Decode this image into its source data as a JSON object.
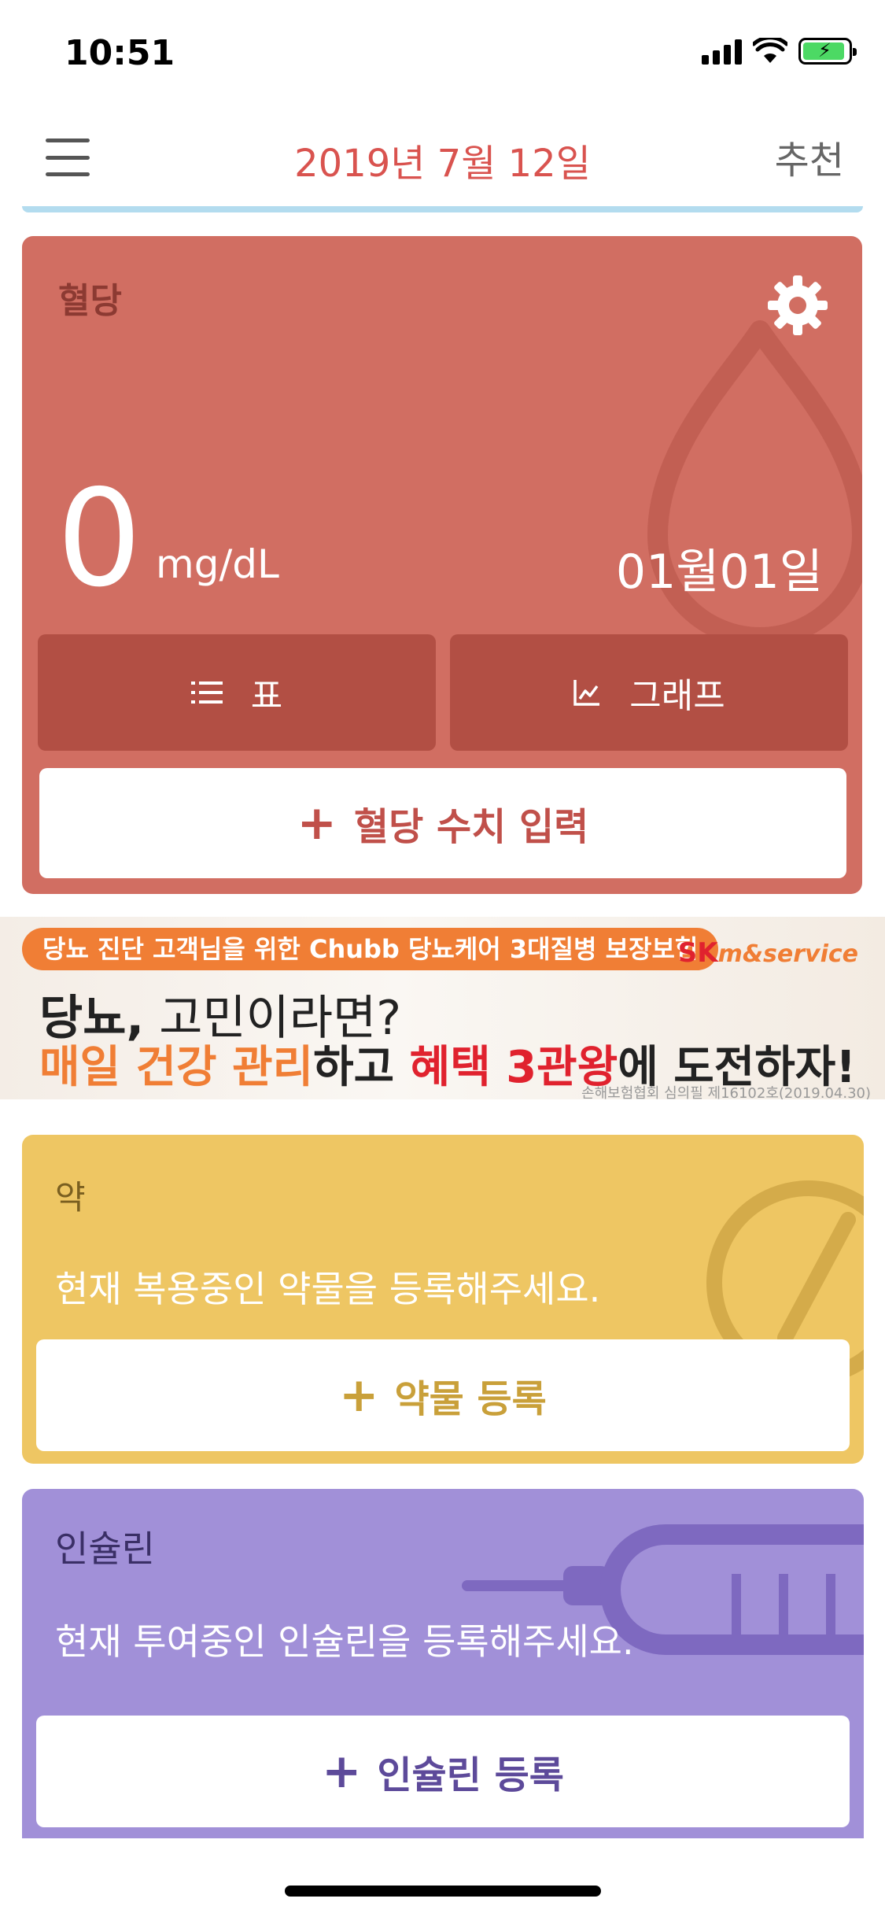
{
  "status_bar": {
    "time": "10:51"
  },
  "header": {
    "date": "2019년 7월 12일",
    "recommend_label": "추천"
  },
  "blood_sugar": {
    "title": "혈당",
    "value": "0",
    "unit": "mg/dL",
    "date": "01월01일",
    "table_label": "표",
    "graph_label": "그래프",
    "input_label": "혈당 수치 입력",
    "colors": {
      "card": "#d16e62",
      "tab": "#b24f44",
      "accent": "#c0504a"
    }
  },
  "banner": {
    "tag": "당뇨 진단 고객님을 위한 Chubb 당뇨케어 3대질병 보장보험",
    "brand_main": "SK",
    "brand_sub": "m&service",
    "line1_bold": "당뇨,",
    "line1_rest": " 고민이라면?",
    "line2_part1": "매일 건강 관리",
    "line2_part2": "하고 ",
    "line2_part3": "혜택 3관왕",
    "line2_part4": "에 도전하자!",
    "note": "손해보험협회 심의필 제16102호(2019.04.30)"
  },
  "medicine": {
    "title": "약",
    "description": "현재 복용중인 약물을 등록해주세요.",
    "button_label": "약물 등록",
    "color": "#eec663"
  },
  "insulin": {
    "title": "인슐린",
    "description": "현재 투여중인 인슐린을 등록해주세요.",
    "button_label": "인슐린 등록",
    "color": "#a190d8"
  },
  "icons": {
    "menu": "hamburger-menu-icon",
    "settings": "gear-icon",
    "list": "list-icon",
    "graph": "line-chart-icon",
    "plus": "plus-icon"
  }
}
